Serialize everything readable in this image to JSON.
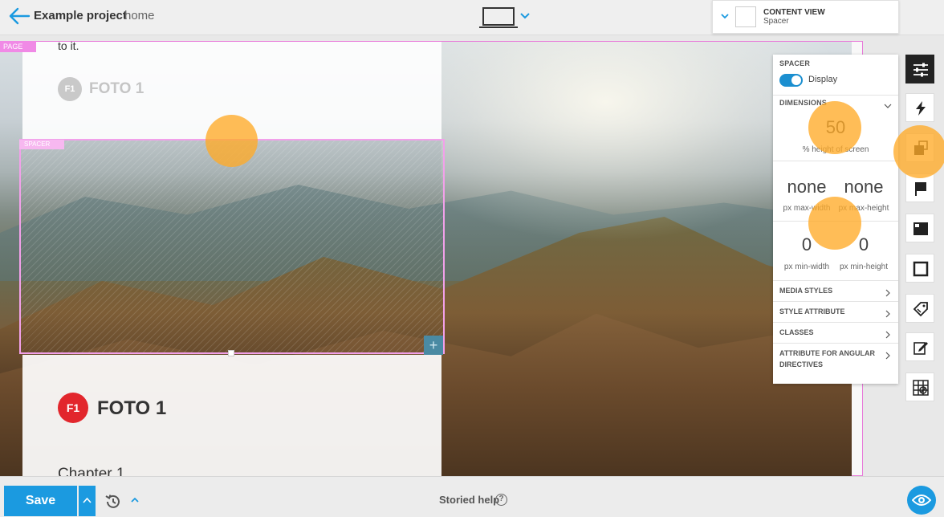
{
  "header": {
    "project_title": "Example project",
    "page_name": "home"
  },
  "content_view": {
    "title": "CONTENT VIEW",
    "subtitle": "Spacer"
  },
  "canvas": {
    "page_badge": "PAGE",
    "spacer_badge": "SPACER",
    "top_text": "to it.",
    "logo_letters": "F1",
    "logo_text": "FOTO 1",
    "chapter_text": "Chapter 1"
  },
  "props": {
    "spacer_title": "SPACER",
    "display_label": "Display",
    "dimensions_title": "DIMENSIONS",
    "height_value": "50",
    "height_label": "% height of screen",
    "max_width_value": "none",
    "max_width_label": "px max-width",
    "max_height_value": "none",
    "max_height_label": "px max-height",
    "min_width_value": "0",
    "min_width_label": "px min-width",
    "min_height_value": "0",
    "min_height_label": "px min-height",
    "media_styles": "MEDIA STYLES",
    "style_attribute": "STYLE ATTRIBUTE",
    "classes": "CLASSES",
    "angular_directives": "ATTRIBUTE FOR ANGULAR DIRECTIVES"
  },
  "footer": {
    "save_label": "Save",
    "help_text": "Storied help",
    "help_icon": "?"
  },
  "icons": [
    "back-arrow-icon",
    "laptop-icon",
    "chevron-down-icon",
    "sliders-icon",
    "lightning-icon",
    "layers-icon",
    "flag-icon",
    "image-icon",
    "frame-icon",
    "tag-icon",
    "edit-icon",
    "grid-icon",
    "history-icon",
    "eye-icon"
  ],
  "colors": {
    "accent": "#1b9ae0",
    "page_outline": "#e879d9",
    "touch_indicator": "#ffaa28",
    "logo_red": "#e2262c"
  }
}
